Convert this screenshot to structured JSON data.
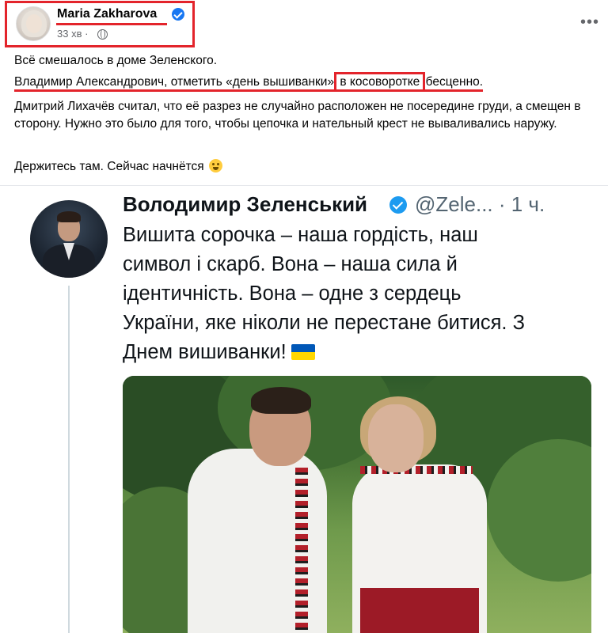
{
  "post": {
    "author": "Maria Zakharova",
    "time": "33 хв",
    "separator": "·",
    "more_label": "•••",
    "paragraph1": "Всё смешалось в доме Зеленского.",
    "paragraph2_part1": "Владимир  Александрович, отметить «день вышиванки»",
    "paragraph2_boxed": "в косоворотке",
    "paragraph2_part2": "бесценно.",
    "paragraph3": "Дмитрий Лихачёв считал, что её разрез не случайно расположен не посередине груди, а смещен в сторону. Нужно это было для того,  чтобы цепочка и нательный крест не вываливались наружу.",
    "paragraph4": "Держитесь там. Сейчас начнётся"
  },
  "tweet": {
    "name": "Володимир Зеленський",
    "handle": "@Zele... · 1 ч.",
    "lines": [
      "Вишита сорочка – наша гордість, наш",
      "символ і скарб. Вона – наша сила й",
      "ідентичність. Вона – одне з сердець",
      "України, яке ніколи не перестане битися. З",
      "Днем вишиванки!"
    ]
  },
  "colors": {
    "highlight": "#e3242b",
    "facebook_blue": "#1877f2",
    "twitter_blue": "#1d9bf0",
    "flag_blue": "#0057b7",
    "flag_yellow": "#ffd700"
  }
}
